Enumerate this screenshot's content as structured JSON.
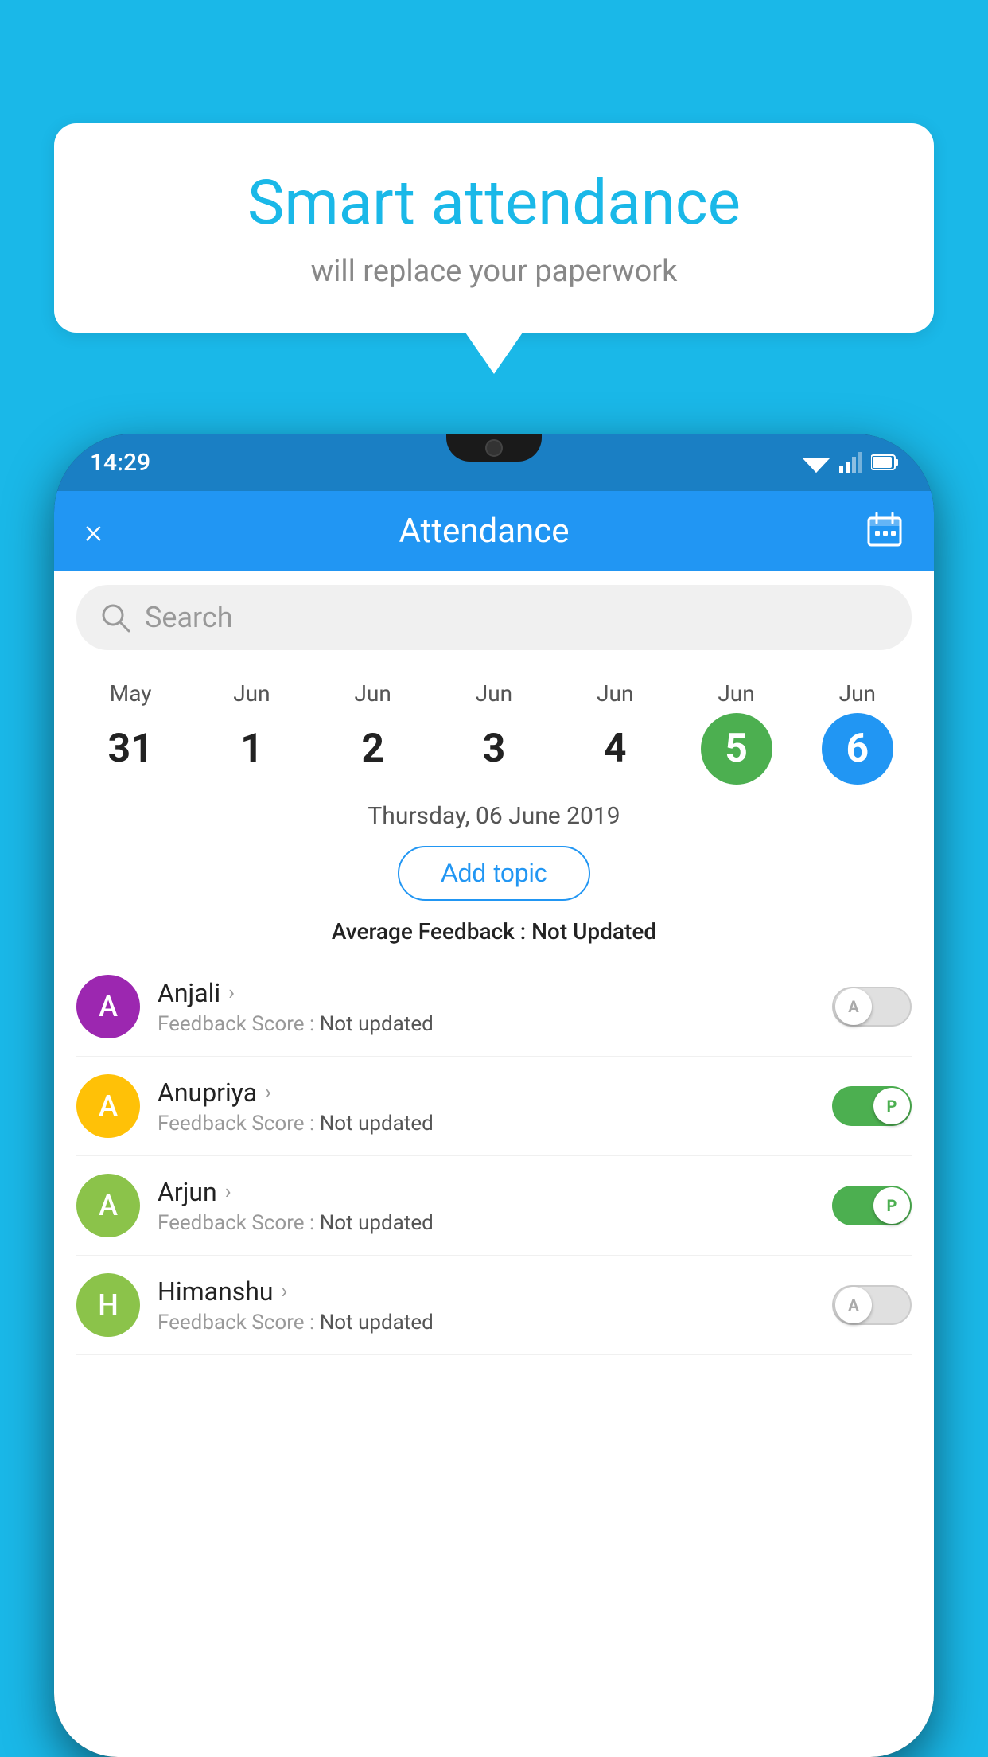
{
  "background_color": "#1ab8e8",
  "speech_bubble": {
    "title": "Smart attendance",
    "subtitle": "will replace your paperwork"
  },
  "phone": {
    "status_bar": {
      "time": "14:29"
    },
    "header": {
      "title": "Attendance",
      "close_label": "×"
    },
    "search": {
      "placeholder": "Search"
    },
    "calendar": {
      "dates": [
        {
          "month": "May",
          "day": "31",
          "style": "normal"
        },
        {
          "month": "Jun",
          "day": "1",
          "style": "normal"
        },
        {
          "month": "Jun",
          "day": "2",
          "style": "normal"
        },
        {
          "month": "Jun",
          "day": "3",
          "style": "normal"
        },
        {
          "month": "Jun",
          "day": "4",
          "style": "normal"
        },
        {
          "month": "Jun",
          "day": "5",
          "style": "green"
        },
        {
          "month": "Jun",
          "day": "6",
          "style": "blue"
        }
      ]
    },
    "selected_date": "Thursday, 06 June 2019",
    "add_topic_label": "Add topic",
    "avg_feedback_label": "Average Feedback : ",
    "avg_feedback_value": "Not Updated",
    "students": [
      {
        "name": "Anjali",
        "avatar_letter": "A",
        "avatar_color": "#9c27b0",
        "score_label": "Feedback Score : ",
        "score_value": "Not updated",
        "toggle": "off",
        "toggle_label": "A"
      },
      {
        "name": "Anupriya",
        "avatar_letter": "A",
        "avatar_color": "#ffc107",
        "score_label": "Feedback Score : ",
        "score_value": "Not updated",
        "toggle": "on",
        "toggle_label": "P"
      },
      {
        "name": "Arjun",
        "avatar_letter": "A",
        "avatar_color": "#8bc34a",
        "score_label": "Feedback Score : ",
        "score_value": "Not updated",
        "toggle": "on",
        "toggle_label": "P"
      },
      {
        "name": "Himanshu",
        "avatar_letter": "H",
        "avatar_color": "#8bc34a",
        "score_label": "Feedback Score : ",
        "score_value": "Not updated",
        "toggle": "off",
        "toggle_label": "A"
      }
    ]
  }
}
